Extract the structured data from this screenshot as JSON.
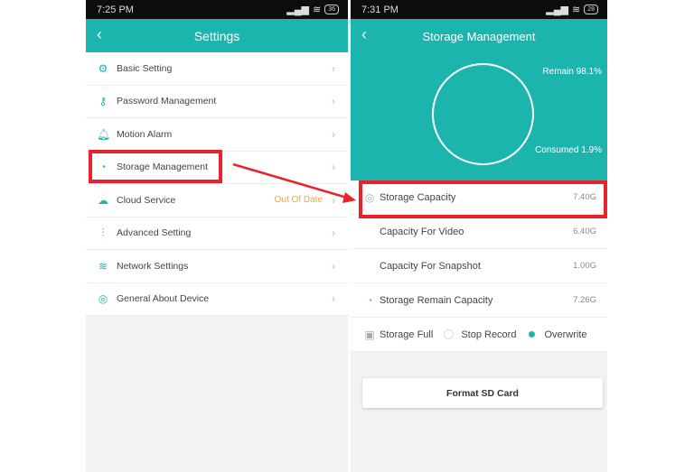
{
  "left": {
    "status": {
      "time": "7:25 PM",
      "battery": "36"
    },
    "title": "Settings",
    "items": [
      {
        "label": "Basic Setting",
        "icon": "gear-icon"
      },
      {
        "label": "Password Management",
        "icon": "key-icon"
      },
      {
        "label": "Motion Alarm",
        "icon": "bell-icon"
      },
      {
        "label": "Storage Management",
        "icon": "storage-icon"
      },
      {
        "label": "Cloud Service",
        "icon": "cloud-icon",
        "badge": "Out Of Date"
      },
      {
        "label": "Advanced Setting",
        "icon": "sliders-icon"
      },
      {
        "label": "Network Settings",
        "icon": "wifi-icon"
      },
      {
        "label": "General About Device",
        "icon": "info-icon"
      }
    ]
  },
  "right": {
    "status": {
      "time": "7:31 PM",
      "battery": "28"
    },
    "title": "Storage Management",
    "remain": "Remain 98.1%",
    "consumed": "Consumed 1.9%",
    "consumed_fraction": 0.019,
    "rows": [
      {
        "label": "Storage Capacity",
        "value": "7.40G"
      },
      {
        "label": "Capacity For Video",
        "value": "6.40G"
      },
      {
        "label": "Capacity For Snapshot",
        "value": "1.00G"
      },
      {
        "label": "Storage Remain Capacity",
        "value": "7.26G"
      }
    ],
    "storage_full": {
      "label": "Storage Full",
      "options": [
        "Stop Record",
        "Overwrite"
      ],
      "selected": "Overwrite"
    },
    "format_button": "Format SD Card"
  },
  "colors": {
    "accent": "#1bb5ad",
    "highlight": "#e8232c",
    "warning": "#f3a63b"
  }
}
